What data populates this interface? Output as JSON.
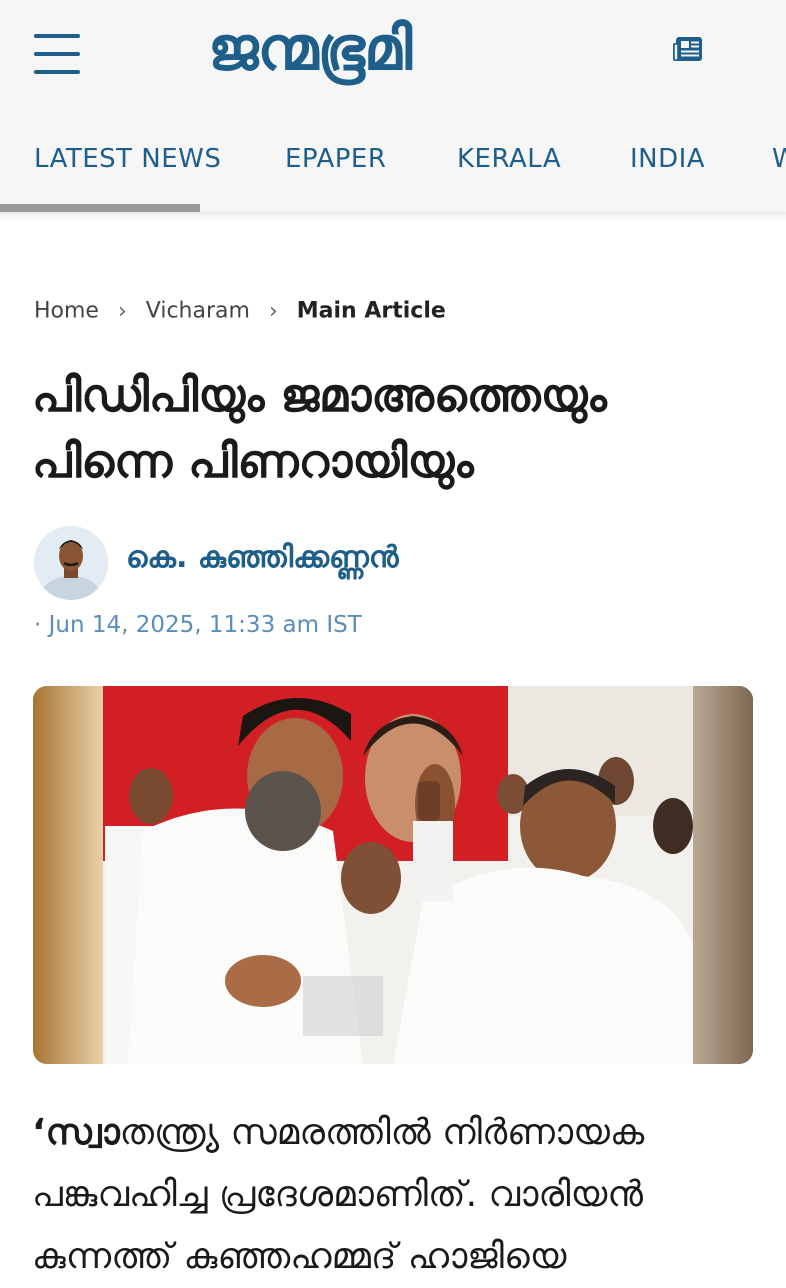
{
  "header": {
    "logo_text": "ജന്മഭൂമി",
    "brand_color": "#1d5f8a",
    "menu_icon": "hamburger-menu-icon",
    "epaper_icon": "newspaper-icon"
  },
  "nav": {
    "tabs": [
      {
        "label": "LATEST NEWS"
      },
      {
        "label": "EPAPER"
      },
      {
        "label": "KERALA"
      },
      {
        "label": "INDIA"
      },
      {
        "label": "W"
      }
    ]
  },
  "breadcrumb": {
    "home": "Home",
    "section": "Vicharam",
    "current": "Main Article",
    "separator": "›"
  },
  "article": {
    "title": "പിഡിപിയും ജമാഅത്തെയും പിന്നെ പിണറായിയും",
    "author": "കെ. കുഞ്ഞിക്കണ്ണന്‍",
    "date_prefix": "·",
    "date": "Jun 14, 2025, 11:33 am IST",
    "body_lead_bold": "‘സ്വാ",
    "body_rest": "തന്ത്ര്യ സമരത്തില്‍ നിര്‍ണായക പങ്കുവഹിച്ച പ്രദേശമാണിത്. വാരിയന്‍ കുന്നത്ത് കുഞ്ഞഹമ്മദ് ഹാജിയെ"
  }
}
